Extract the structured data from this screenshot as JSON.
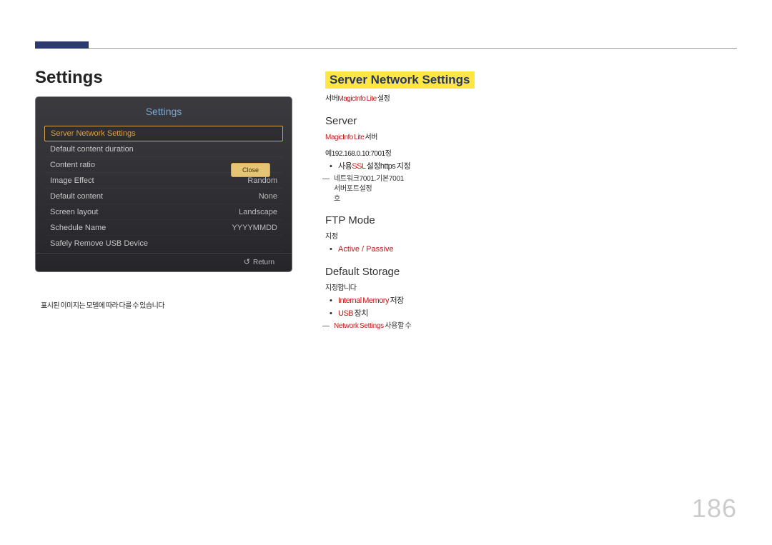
{
  "page": {
    "number": "186",
    "left_title": "Settings"
  },
  "tv": {
    "title": "Settings",
    "close": "Close",
    "return": "Return",
    "items": [
      {
        "label": "Server Network Settings",
        "value": ""
      },
      {
        "label": "Default content duration",
        "value": ""
      },
      {
        "label": "Content ratio",
        "value": ""
      },
      {
        "label": "Image Effect",
        "value": "Random"
      },
      {
        "label": "Default content",
        "value": "None"
      },
      {
        "label": "Screen layout",
        "value": "Landscape"
      },
      {
        "label": "Schedule Name",
        "value": "YYYYMMDD"
      },
      {
        "label": "Safely Remove USB Device",
        "value": ""
      }
    ]
  },
  "left_footnote": "표시된 이미지는 모델에 따라 다를 수 있습니다",
  "right": {
    "heading": "Server Network Settings",
    "intro_pre": "서버",
    "intro_hl": "MagicInfo Lite",
    "intro_post": " 설정",
    "server_h": "Server",
    "server_line1_hl": "MagicInfo Lite",
    "server_line1_post": " 서버",
    "server_line2_pre": "예192.168.0.10:7001",
    "server_line2_post": "정",
    "server_bullet_pre": "사용",
    "server_bullet_hl": "SSL",
    "server_bullet_mid": " 설정https",
    "server_bullet_post": " 지정",
    "server_note1": "네트워크7001.기본7001",
    "server_note2": "서버포트설정",
    "server_note3": "호",
    "ftp_h": "FTP Mode",
    "ftp_line": "지정",
    "ftp_opt1": "Active",
    "ftp_sep": " / ",
    "ftp_opt2": "Passive",
    "storage_h": "Default Storage",
    "storage_line": "지정합니다",
    "storage_opt1": "Internal Memory",
    "storage_opt1_post": " 저장",
    "storage_opt2": "USB",
    "storage_opt2_post": " 장치",
    "storage_note_hl": "Network Settings",
    "storage_note_post": " 사용할 수"
  }
}
